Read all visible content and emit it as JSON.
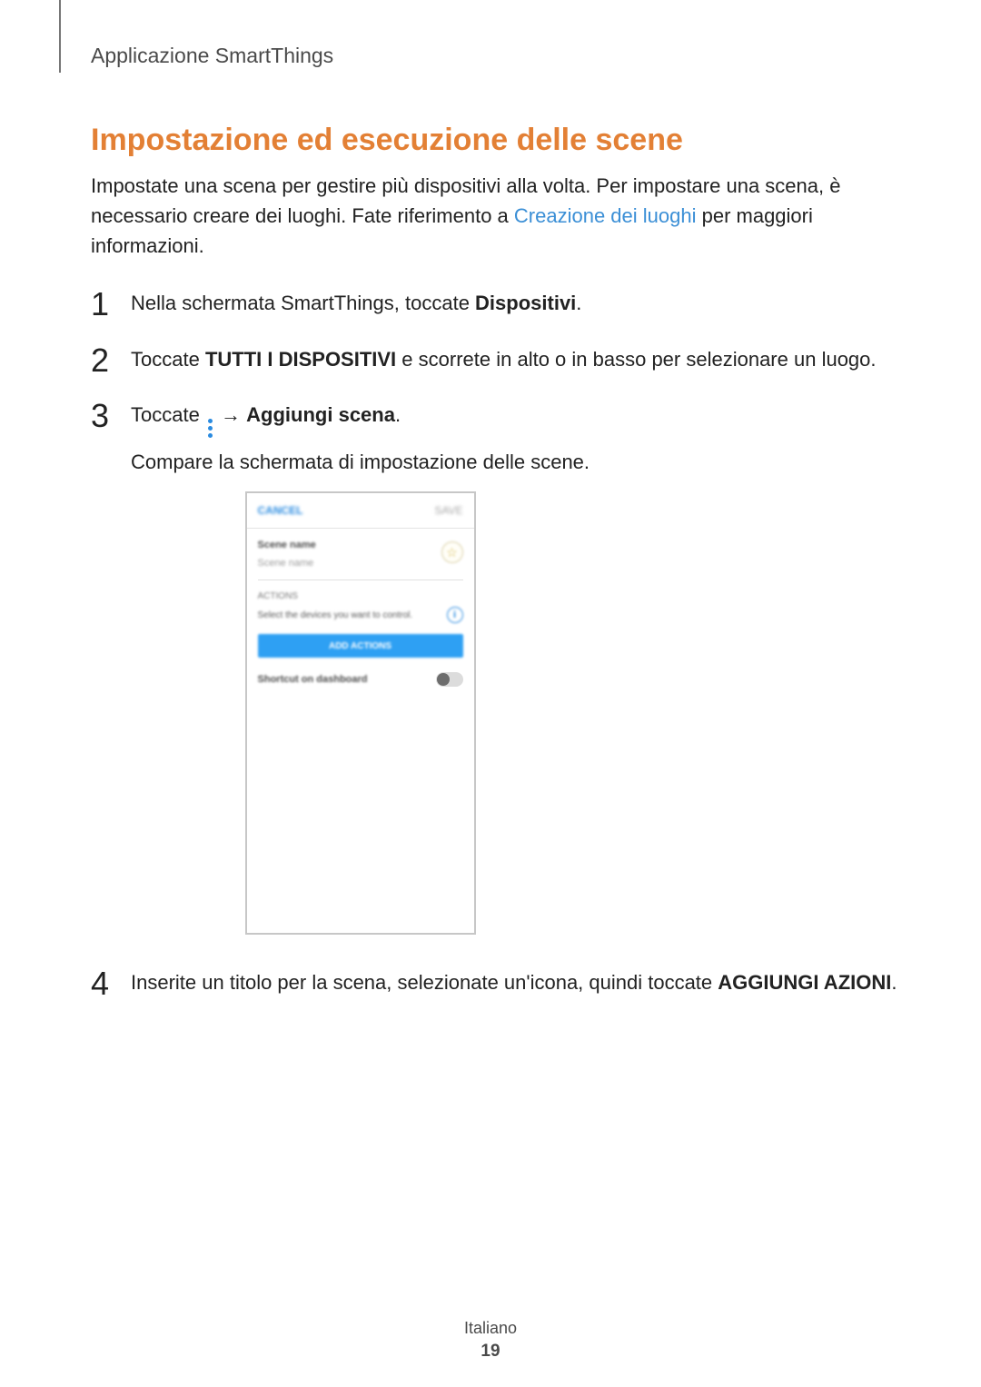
{
  "runningHead": "Applicazione SmartThings",
  "heading": "Impostazione ed esecuzione delle scene",
  "intro": {
    "part1": "Impostate una scena per gestire più dispositivi alla volta. Per impostare una scena, è necessario creare dei luoghi. Fate riferimento a ",
    "link": "Creazione dei luoghi",
    "part2": " per maggiori informazioni."
  },
  "steps": {
    "n1": "1",
    "s1a": "Nella schermata SmartThings, toccate ",
    "s1b": "Dispositivi",
    "s1c": ".",
    "n2": "2",
    "s2a": "Toccate ",
    "s2b": "TUTTI I DISPOSITIVI",
    "s2c": " e scorrete in alto o in basso per selezionare un luogo.",
    "n3": "3",
    "s3a": "Toccate ",
    "s3arrow": " → ",
    "s3b": "Aggiungi scena",
    "s3c": ".",
    "s3sub": "Compare la schermata di impostazione delle scene.",
    "n4": "4",
    "s4a": "Inserite un titolo per la scena, selezionate un'icona, quindi toccate ",
    "s4b": "AGGIUNGI AZIONI",
    "s4c": "."
  },
  "phone": {
    "cancel": "CANCEL",
    "save": "SAVE",
    "sceneNameLabel": "Scene name",
    "sceneNamePh": "Scene name",
    "star": "☆",
    "actionsLabel": "ACTIONS",
    "selectDevices": "Select the devices you want to control.",
    "info": "i",
    "addActions": "ADD ACTIONS",
    "shortcut": "Shortcut on dashboard"
  },
  "footer": {
    "lang": "Italiano",
    "page": "19"
  }
}
